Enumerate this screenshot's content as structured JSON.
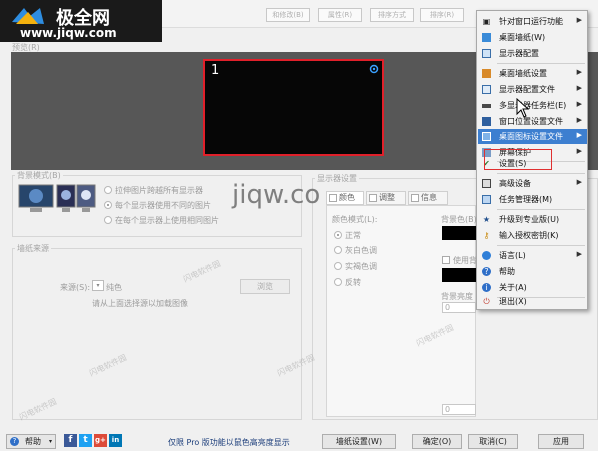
{
  "watermark": {
    "brand": "极全网",
    "url": "www.jiqw.com",
    "center_text": "jiqw.co",
    "repeat_text": "闪电软件园"
  },
  "toolbar": {
    "buttons": [
      "和修改(B)",
      "属性(R)",
      "排序方式",
      "排序(R)"
    ]
  },
  "preview": {
    "label": "预览(R)",
    "monitor_number": "1"
  },
  "background_mode": {
    "title": "背景模式(B)",
    "options": [
      {
        "label": "拉伸图片跨越所有显示器",
        "selected": false
      },
      {
        "label": "每个显示器使用不同的图片",
        "selected": true
      },
      {
        "label": "在每个显示器上使用相同图片",
        "selected": false
      }
    ]
  },
  "wallpaper_source": {
    "title": "墙纸来源",
    "source_label": "来源(S):",
    "source_value": "纯色",
    "hint": "请从上面选择源以加载图像",
    "browse_button": "浏览"
  },
  "monitor_settings": {
    "title": "显示器设置",
    "tabs": [
      "颜色",
      "调整",
      "信息"
    ],
    "color_mode_label": "颜色模式(L):",
    "color_modes": [
      {
        "label": "正常",
        "selected": true
      },
      {
        "label": "灰白色调",
        "selected": false
      },
      {
        "label": "实褐色调",
        "selected": false
      },
      {
        "label": "反转",
        "selected": false
      }
    ],
    "bg_color_label": "背景色(B):",
    "use_bg_label": "使用背景",
    "bg_opacity_label": "背景亮度",
    "bg_opacity_value": "0",
    "bottom_value": "0"
  },
  "context_menu": {
    "items": [
      {
        "label": "针对窗口运行功能",
        "icon": "window-icon",
        "submenu": true,
        "highlight": false
      },
      {
        "label": "桌面墙纸(W)",
        "icon": "wallpaper-icon",
        "submenu": false,
        "highlight": false
      },
      {
        "label": "显示器配置",
        "icon": "monitor-icon",
        "submenu": false,
        "highlight": false
      },
      {
        "label": "桌面墙纸设置",
        "icon": "wallpaper-settings-icon",
        "submenu": true,
        "highlight": false
      },
      {
        "label": "显示器配置文件",
        "icon": "monitor-profile-icon",
        "submenu": true,
        "highlight": false
      },
      {
        "label": "多显示器任务栏(E)",
        "icon": "taskbar-icon",
        "submenu": true,
        "highlight": false
      },
      {
        "label": "窗口位置设置文件",
        "icon": "window-position-icon",
        "submenu": true,
        "highlight": false
      },
      {
        "label": "桌面图标设置文件",
        "icon": "desktop-icons-icon",
        "submenu": true,
        "highlight": true
      },
      {
        "label": "屏幕保护",
        "icon": "screensaver-icon",
        "submenu": true,
        "highlight": false
      },
      {
        "label": "设置(S)",
        "icon": "settings-icon",
        "submenu": false,
        "highlight": false
      },
      {
        "label": "高级设备",
        "icon": "advanced-device-icon",
        "submenu": true,
        "highlight": false
      },
      {
        "label": "任务管理器(M)",
        "icon": "task-manager-icon",
        "submenu": false,
        "highlight": false
      },
      {
        "label": "升级到专业版(U)",
        "icon": "star-icon",
        "submenu": false,
        "highlight": false
      },
      {
        "label": "输入授权密钥(K)",
        "icon": "key-icon",
        "submenu": false,
        "highlight": false
      },
      {
        "label": "语言(L)",
        "icon": "language-icon",
        "submenu": true,
        "highlight": false
      },
      {
        "label": "帮助",
        "icon": "help-icon",
        "submenu": false,
        "highlight": false
      },
      {
        "label": "关于(A)",
        "icon": "info-icon",
        "submenu": false,
        "highlight": false
      },
      {
        "label": "退出(X)",
        "icon": "exit-icon",
        "submenu": false,
        "highlight": false
      }
    ]
  },
  "bottom": {
    "help_button": "帮助",
    "social": [
      "f",
      "t",
      "g+",
      "in"
    ],
    "pro_note": "仅限 Pro 版功能以鼠色高亮度显示",
    "wallpaper_settings_button": "墙纸设置(W)",
    "ok_button": "确定(O)",
    "cancel_button": "取消(C)",
    "apply_button": "应用"
  },
  "colors": {
    "highlight": "#3d7fd0",
    "monitor_border": "#e0202a",
    "annotation": "#e03030",
    "facebook": "#3b5998",
    "twitter": "#1da1f2",
    "googleplus": "#dd4b39",
    "linkedin": "#0077b5"
  }
}
